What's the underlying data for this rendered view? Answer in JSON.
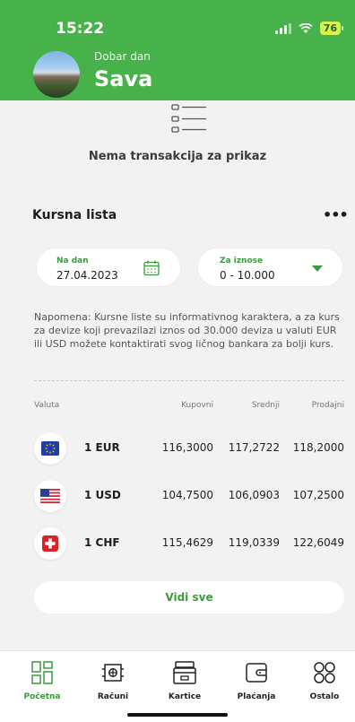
{
  "status_bar": {
    "time": "15:22",
    "battery": "76"
  },
  "header": {
    "greeting": "Dobar dan",
    "name": "Sava"
  },
  "transactions": {
    "empty_message": "Nema transakcija za prikaz"
  },
  "exchange": {
    "title": "Kursna lista",
    "date_label": "Na dan",
    "date_value": "27.04.2023",
    "amount_label": "Za iznose",
    "amount_value": "0 - 10.000",
    "note": "Napomena: Kursne liste su informativnog karaktera, a za kurs za devize koji prevazilazi iznos od 30.000 deviza u valuti EUR ili USD možete kontaktirati svog ličnog bankara za bolji kurs.",
    "headers": {
      "currency": "Valuta",
      "buy": "Kupovni",
      "mid": "Srednji",
      "sell": "Prodajni"
    },
    "rows": [
      {
        "currency": "1 EUR",
        "buy": "116,3000",
        "mid": "117,2722",
        "sell": "118,2000",
        "flag": "eu-flag-icon"
      },
      {
        "currency": "1 USD",
        "buy": "104,7500",
        "mid": "106,0903",
        "sell": "107,2500",
        "flag": "us-flag-icon"
      },
      {
        "currency": "1 CHF",
        "buy": "115,4629",
        "mid": "119,0339",
        "sell": "122,6049",
        "flag": "ch-flag-icon"
      }
    ],
    "see_all": "Vidi sve"
  },
  "tabs": [
    {
      "label": "Početna",
      "icon": "home-grid-icon",
      "active": true
    },
    {
      "label": "Računi",
      "icon": "accounts-icon",
      "active": false
    },
    {
      "label": "Kartice",
      "icon": "cards-icon",
      "active": false
    },
    {
      "label": "Plaćanja",
      "icon": "wallet-icon",
      "active": false
    },
    {
      "label": "Ostalo",
      "icon": "more-circles-icon",
      "active": false
    }
  ],
  "colors": {
    "brand_green": "#46b249",
    "accent_green": "#3a9a3d",
    "battery": "#d8f34a"
  }
}
